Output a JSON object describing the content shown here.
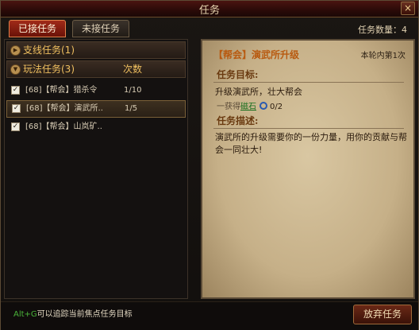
{
  "window": {
    "title": "任务",
    "close_label": "×"
  },
  "tabs": [
    {
      "label": "已接任务",
      "active": true
    },
    {
      "label": "未接任务",
      "active": false
    }
  ],
  "task_count": "任务数量：4",
  "categories": [
    {
      "label": "支线任务(1)",
      "count_header": ""
    },
    {
      "label": "玩法任务(3)",
      "count_header": "次数"
    }
  ],
  "quests": [
    {
      "name": "[68]【帮会】猎杀令",
      "progress": "1/10",
      "checked": true,
      "selected": false
    },
    {
      "name": "[68]【帮会】演武所..",
      "progress": "1/5",
      "checked": true,
      "selected": true
    },
    {
      "name": "[68]【帮会】山岚矿..",
      "progress": "",
      "checked": true,
      "selected": false
    }
  ],
  "detail": {
    "title": "【帮会】演武所升级",
    "round": "本轮内第1次",
    "objective_header": "任务目标:",
    "objective_text": "升级演武所，壮大帮会",
    "objective_prefix": "一获得",
    "objective_item": "磁石",
    "objective_progress": "0/2",
    "description_header": "任务描述:",
    "description_text": "演武所的升级需要你的一份力量，用你的贡献与帮会一同壮大!"
  },
  "footer": {
    "hint_key": "Alt+G",
    "hint_text": "可以追踪当前焦点任务目标",
    "abandon_label": "放弃任务"
  },
  "colors": {
    "accent": "#f0c060",
    "tab_active": "#a02a18",
    "link": "#1a7020"
  }
}
